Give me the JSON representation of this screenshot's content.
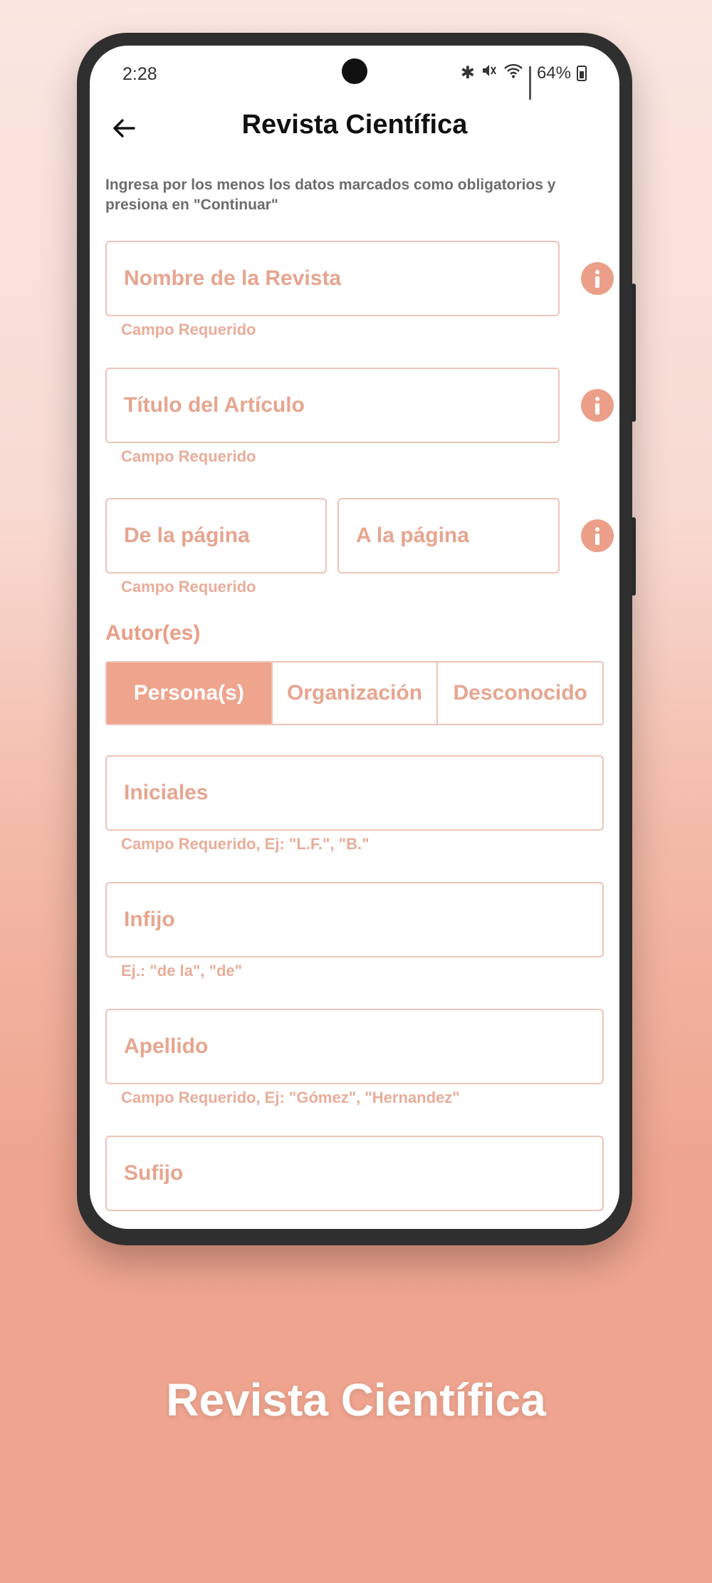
{
  "status_bar": {
    "time": "2:28",
    "battery": "64%"
  },
  "header": {
    "title": "Revista Científica"
  },
  "instructions": "Ingresa por los menos los datos marcados como obligatorios y presiona en \"Continuar\"",
  "form": {
    "journal_name": {
      "placeholder": "Nombre de la Revista",
      "hint": "Campo Requerido"
    },
    "article_title": {
      "placeholder": "Título del Artículo",
      "hint": "Campo Requerido"
    },
    "page_from": {
      "placeholder": "De la página"
    },
    "page_to": {
      "placeholder": "A la página"
    },
    "pages_hint": "Campo Requerido",
    "authors_label": "Autor(es)",
    "author_types": [
      "Persona(s)",
      "Organización",
      "Desconocido"
    ],
    "selected_author_type": "Persona(s)",
    "initials": {
      "placeholder": "Iniciales",
      "hint": "Campo Requerido, Ej: \"L.F.\", \"B.\""
    },
    "infix": {
      "placeholder": "Infijo",
      "hint": "Ej.: \"de la\", \"de\""
    },
    "surname": {
      "placeholder": "Apellido",
      "hint": "Campo Requerido, Ej: \"Gómez\", \"Hernandez\""
    },
    "suffix": {
      "placeholder": "Sufijo"
    }
  },
  "caption": "Revista Científica",
  "colors": {
    "accent": "#efa48d",
    "border": "#ecc4b7",
    "placeholder": "#e7a58f"
  }
}
